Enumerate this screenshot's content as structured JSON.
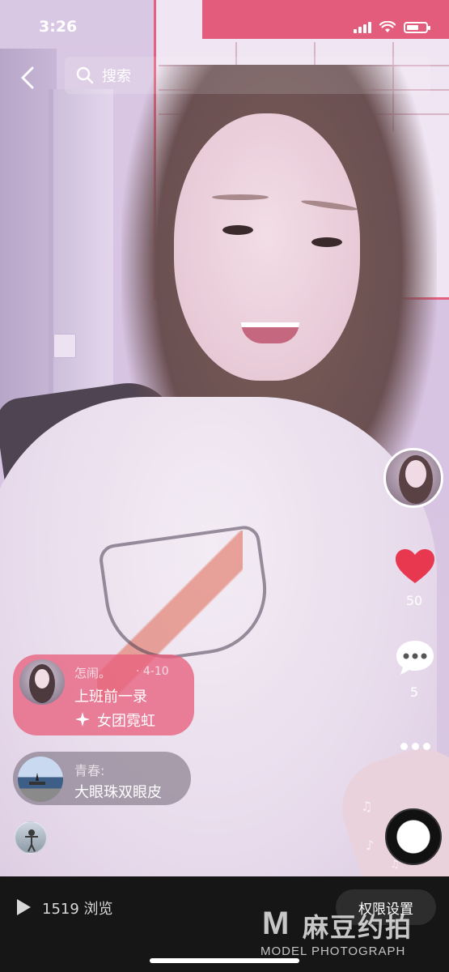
{
  "status_bar": {
    "time": "3:26"
  },
  "nav": {
    "search_placeholder": "搜索"
  },
  "rail": {
    "like_count": "50",
    "comment_count": "5"
  },
  "comments": [
    {
      "user": "怎闹。",
      "date": "· 4-10",
      "message": "上班前一录",
      "sticker": "女团霓虹"
    },
    {
      "user": "青春:",
      "message": "大眼珠双眼皮"
    }
  ],
  "bottom_bar": {
    "views": "1519 浏览",
    "permission_button": "权限设置"
  },
  "watermark": {
    "mark": "M",
    "cn": "麻豆约拍",
    "en": "MODEL PHOTOGRAPH"
  },
  "colors": {
    "like_red": "#e8384f",
    "card_pink": "#e8607d",
    "bottom_bg": "#161616"
  }
}
